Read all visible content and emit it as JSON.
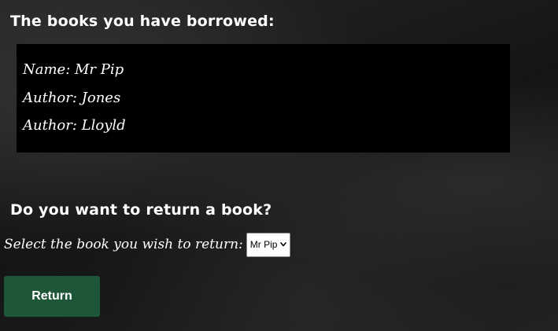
{
  "borrowed": {
    "heading": "The books you have borrowed:",
    "lines": [
      "Name: Mr Pip",
      "Author: Jones",
      "Author: Lloyld"
    ]
  },
  "return_section": {
    "heading": "Do you want to return a book?",
    "select_label": "Select the book you wish to return:",
    "selected_book": "Mr Pip",
    "button_label": "Return"
  },
  "colors": {
    "button": "#1e5638",
    "panel": "#000000",
    "text": "#ffffff"
  },
  "icons": {
    "select_arrow": "chevron-down-icon"
  }
}
